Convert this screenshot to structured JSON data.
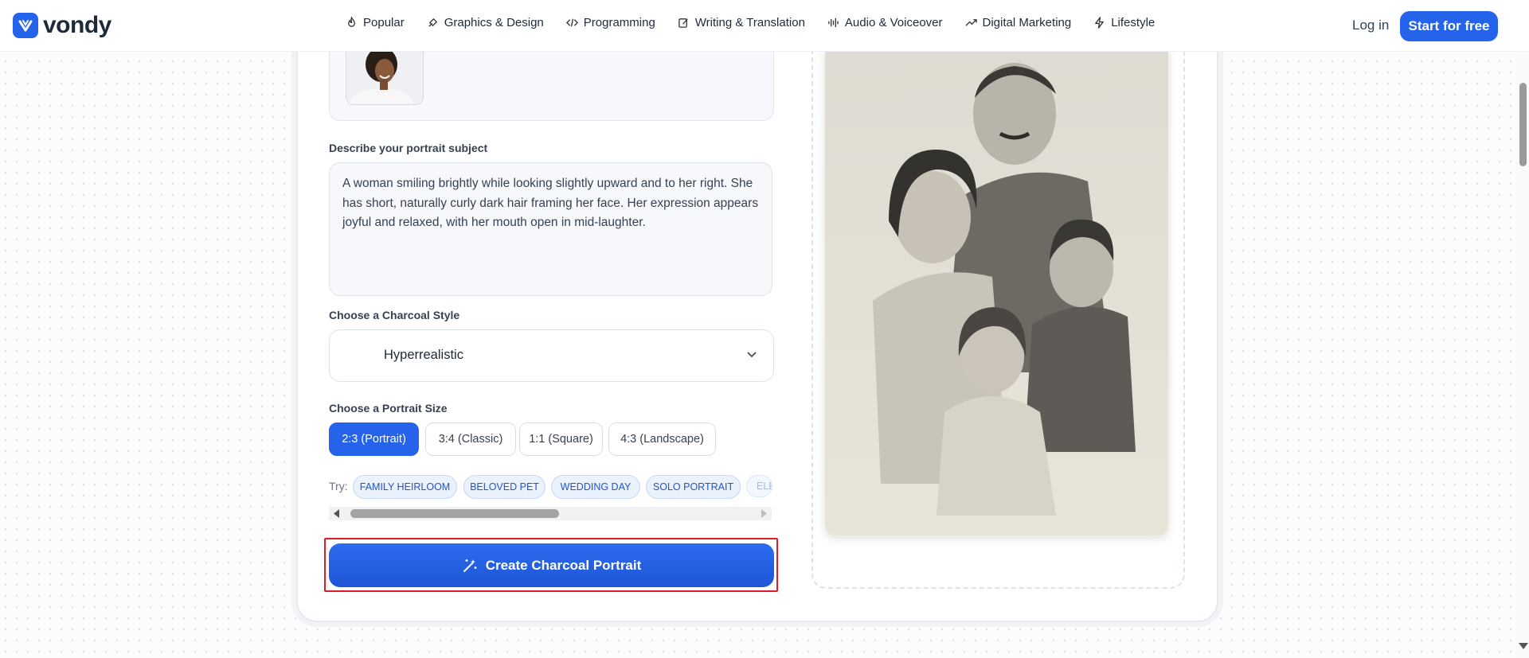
{
  "brand": {
    "name": "vondy",
    "color": "#2563eb"
  },
  "nav": {
    "items": [
      {
        "label": "Popular",
        "icon": "flame-icon"
      },
      {
        "label": "Graphics & Design",
        "icon": "brush-icon"
      },
      {
        "label": "Programming",
        "icon": "code-icon"
      },
      {
        "label": "Writing & Translation",
        "icon": "edit-icon"
      },
      {
        "label": "Audio & Voiceover",
        "icon": "audio-wave-icon"
      },
      {
        "label": "Digital Marketing",
        "icon": "trend-up-icon"
      },
      {
        "label": "Lifestyle",
        "icon": "bolt-icon"
      }
    ],
    "login": "Log in",
    "start": "Start for free"
  },
  "form": {
    "describe_label": "Describe your portrait subject",
    "description": "A woman smiling brightly while looking slightly upward and to her right. She has short, naturally curly dark hair framing her face. Her expression appears joyful and relaxed, with her mouth open in mid-laughter.",
    "style_label": "Choose a Charcoal Style",
    "style_value": "Hyperrealistic",
    "size_label": "Choose a Portrait Size",
    "sizes": [
      "2:3 (Portrait)",
      "3:4 (Classic)",
      "1:1 (Square)",
      "4:3 (Landscape)"
    ],
    "selected_size": "2:3 (Portrait)",
    "try_label": "Try:",
    "suggestions": [
      "FAMILY HEIRLOOM",
      "BELOVED PET",
      "WEDDING DAY",
      "SOLO PORTRAIT",
      "ELE"
    ],
    "cta": "Create Charcoal Portrait"
  }
}
